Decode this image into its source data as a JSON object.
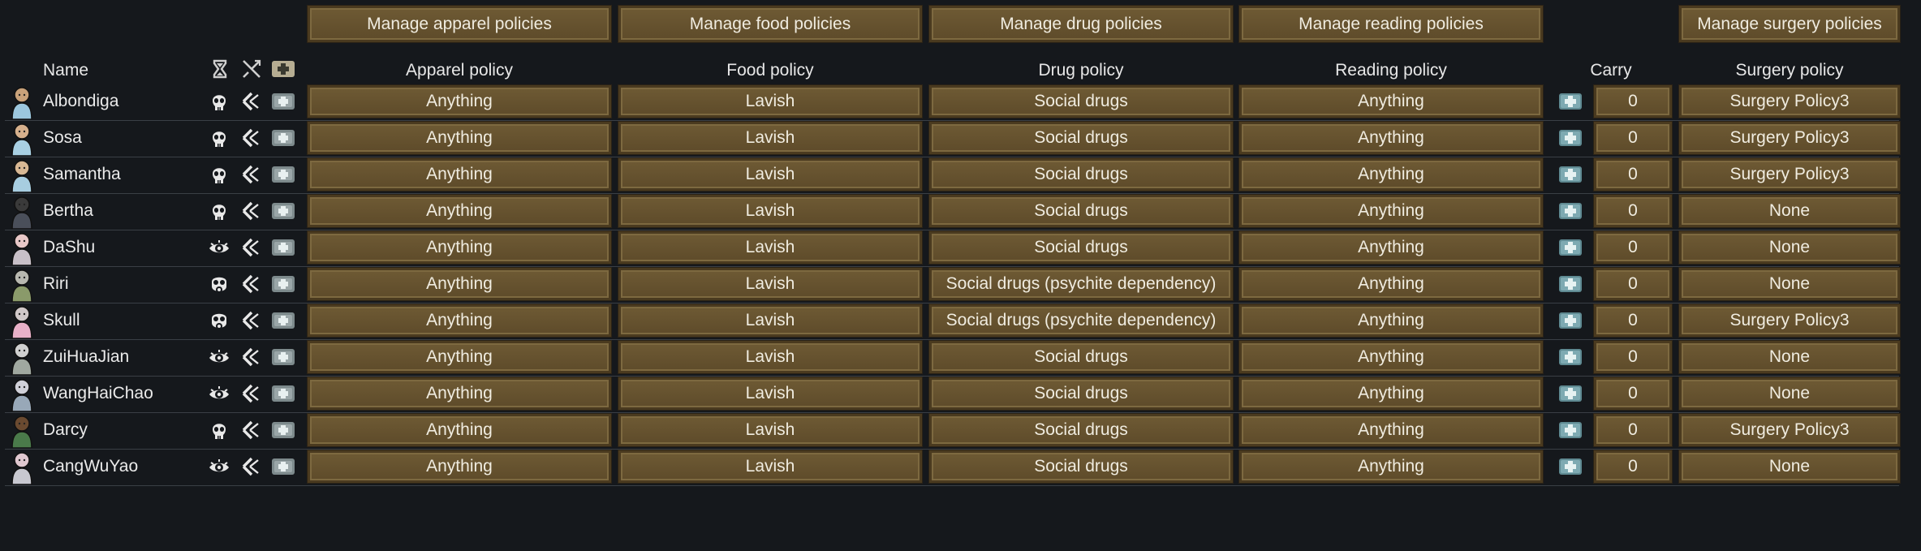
{
  "toolbar": {
    "manage_apparel": "Manage apparel policies",
    "manage_food": "Manage food policies",
    "manage_drug": "Manage drug policies",
    "manage_reading": "Manage reading policies",
    "manage_surgery": "Manage surgery policies"
  },
  "headers": {
    "name": "Name",
    "apparel": "Apparel policy",
    "food": "Food policy",
    "drug": "Drug policy",
    "reading": "Reading policy",
    "carry": "Carry",
    "surgery": "Surgery policy",
    "icons": [
      "hourglass-icon",
      "no-melee-icon",
      "medical-plus-icon"
    ]
  },
  "colors": {
    "background": "#15181c",
    "button": "#6e5a34",
    "button_border": "#4a3a1f",
    "text": "#e6e6e6"
  },
  "pawns": [
    {
      "name": "Albondiga",
      "status_icon": "skull-icon",
      "apparel": "Anything",
      "food": "Lavish",
      "drug": "Social drugs",
      "reading": "Anything",
      "carry": "0",
      "surgery": "Surgery Policy3"
    },
    {
      "name": "Sosa",
      "status_icon": "skull-icon",
      "apparel": "Anything",
      "food": "Lavish",
      "drug": "Social drugs",
      "reading": "Anything",
      "carry": "0",
      "surgery": "Surgery Policy3"
    },
    {
      "name": "Samantha",
      "status_icon": "skull-icon",
      "apparel": "Anything",
      "food": "Lavish",
      "drug": "Social drugs",
      "reading": "Anything",
      "carry": "0",
      "surgery": "Surgery Policy3"
    },
    {
      "name": "Bertha",
      "status_icon": "skull-icon",
      "apparel": "Anything",
      "food": "Lavish",
      "drug": "Social drugs",
      "reading": "Anything",
      "carry": "0",
      "surgery": "None"
    },
    {
      "name": "DaShu",
      "status_icon": "eye-icon",
      "apparel": "Anything",
      "food": "Lavish",
      "drug": "Social drugs",
      "reading": "Anything",
      "carry": "0",
      "surgery": "None"
    },
    {
      "name": "Riri",
      "status_icon": "gasmask-icon",
      "apparel": "Anything",
      "food": "Lavish",
      "drug": "Social drugs (psychite dependency)",
      "reading": "Anything",
      "carry": "0",
      "surgery": "None"
    },
    {
      "name": "Skull",
      "status_icon": "gasmask-icon",
      "apparel": "Anything",
      "food": "Lavish",
      "drug": "Social drugs (psychite dependency)",
      "reading": "Anything",
      "carry": "0",
      "surgery": "Surgery Policy3"
    },
    {
      "name": "ZuiHuaJian",
      "status_icon": "eye-icon",
      "apparel": "Anything",
      "food": "Lavish",
      "drug": "Social drugs",
      "reading": "Anything",
      "carry": "0",
      "surgery": "None"
    },
    {
      "name": "WangHaiChao",
      "status_icon": "eye-icon",
      "apparel": "Anything",
      "food": "Lavish",
      "drug": "Social drugs",
      "reading": "Anything",
      "carry": "0",
      "surgery": "None"
    },
    {
      "name": "Darcy",
      "status_icon": "skull-icon",
      "apparel": "Anything",
      "food": "Lavish",
      "drug": "Social drugs",
      "reading": "Anything",
      "carry": "0",
      "surgery": "Surgery Policy3"
    },
    {
      "name": "CangWuYao",
      "status_icon": "eye-icon",
      "apparel": "Anything",
      "food": "Lavish",
      "drug": "Social drugs",
      "reading": "Anything",
      "carry": "0",
      "surgery": "None"
    }
  ]
}
